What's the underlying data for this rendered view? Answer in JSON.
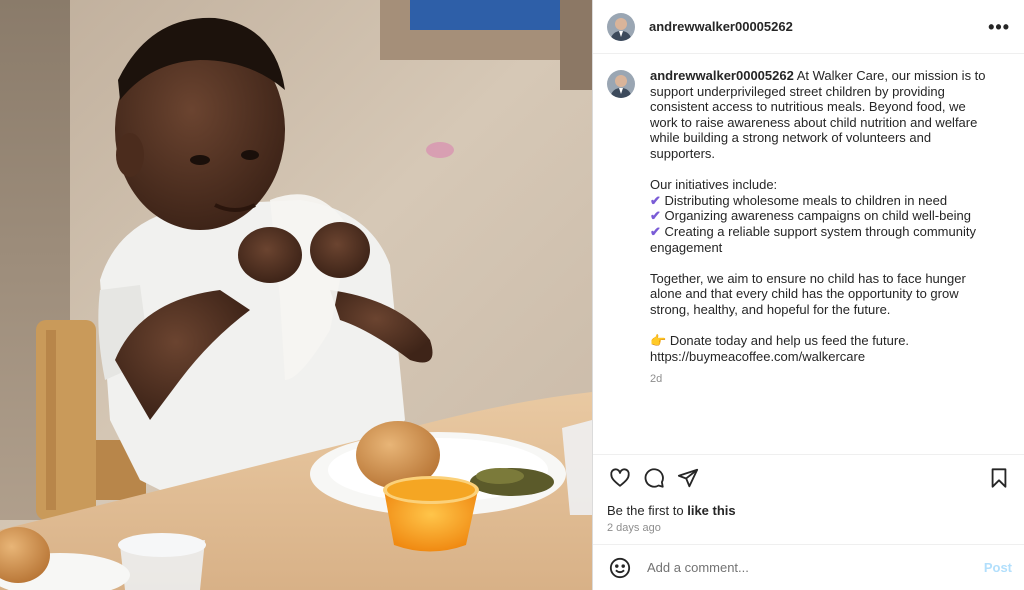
{
  "post": {
    "username": "andrewwalker00005262",
    "caption": {
      "intro": "At Walker Care, our mission is to support underprivileged street children by providing consistent access to nutritious meals. Beyond food, we work to raise awareness about child nutrition and welfare while building a strong network of volunteers and supporters.",
      "initiatives_heading": "Our initiatives include:",
      "initiatives": [
        "Distributing wholesome meals to children in need",
        "Organizing awareness campaigns on child well-being",
        "Creating a reliable support system through community engagement"
      ],
      "closing": "Together, we aim to ensure no child has to face hunger alone and that every child has the opportunity to grow strong, healthy, and hopeful for the future.",
      "cta": "Donate today and help us feed the future.",
      "link": "https://buymeacoffee.com/walkercare",
      "check_glyph": "✔",
      "cta_glyph": "👉",
      "time": "2d"
    },
    "likes_prefix": "Be the first to",
    "likes_action": "like this",
    "posted_time": "2 days ago",
    "comment_placeholder": "Add a comment...",
    "post_button": "Post",
    "more_glyph": "•••"
  },
  "icons": {
    "like": "heart-icon",
    "comment": "comment-icon",
    "share": "share-icon",
    "save": "bookmark-icon",
    "emoji": "emoji-icon",
    "more": "more-options-icon"
  },
  "colors": {
    "accent_link": "#b2dffc",
    "muted": "#8e8e8e",
    "check": "#7a5cd6"
  }
}
